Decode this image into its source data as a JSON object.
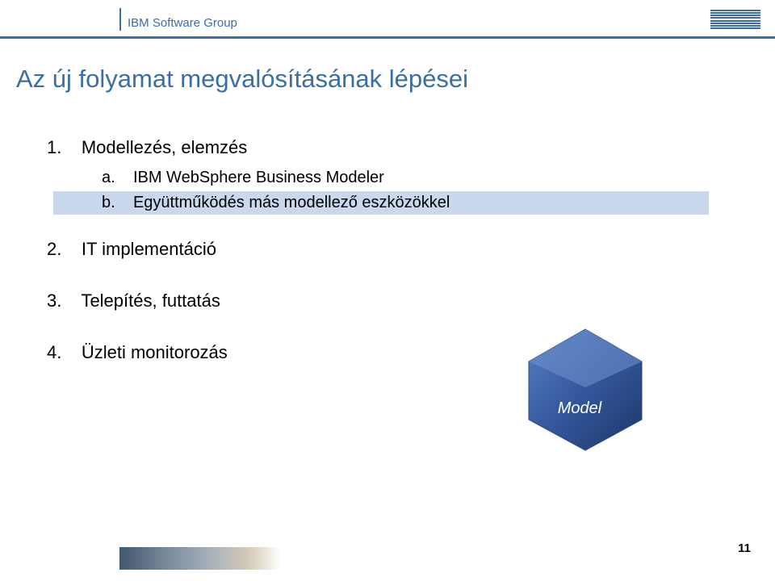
{
  "header": {
    "group_label": "IBM Software Group",
    "logo_name": "ibm-logo"
  },
  "title": "Az új folyamat megvalósításának lépései",
  "list": {
    "item1_num": "1.",
    "item1_text": "Modellezés, elemzés",
    "item1a_num": "a.",
    "item1a_text": "IBM WebSphere Business Modeler",
    "item1b_num": "b.",
    "item1b_text": "Együttműködés más modellező eszközökkel",
    "item2_num": "2.",
    "item2_text": "IT implementáció",
    "item3_num": "3.",
    "item3_text": "Telepítés, futtatás",
    "item4_num": "4.",
    "item4_text": "Üzleti monitorozás"
  },
  "hexagon": {
    "label": "Model"
  },
  "page_number": "11"
}
